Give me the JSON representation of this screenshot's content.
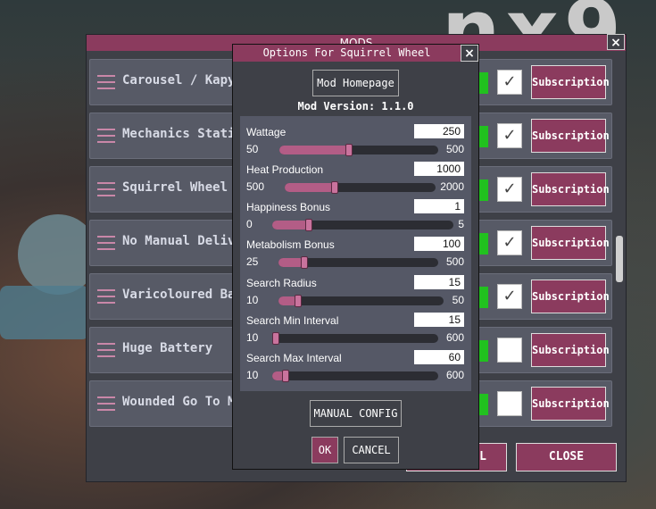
{
  "background": {
    "logo_text": "nx9"
  },
  "mods_window": {
    "title": "MODS",
    "close_icon": "×",
    "rows": [
      {
        "name": "Carousel / Карусель",
        "enabled": true,
        "subscription": "Subscription"
      },
      {
        "name": "Mechanics Station / ",
        "enabled": true,
        "subscription": "Subscription"
      },
      {
        "name": "Squirrel Wheel / Бе",
        "enabled": true,
        "subscription": "Subscription"
      },
      {
        "name": "No Manual Delivery",
        "enabled": true,
        "subscription": "Subscription"
      },
      {
        "name": "Varicoloured Balloon",
        "enabled": true,
        "subscription": "Subscription"
      },
      {
        "name": "Huge Battery",
        "enabled": false,
        "subscription": "Subscription"
      },
      {
        "name": "Wounded Go To Me",
        "enabled": false,
        "subscription": "Subscription"
      }
    ],
    "checkmark": "✓",
    "footer_left_fragment": "L",
    "close_button": "CLOSE"
  },
  "options_dialog": {
    "title": "Options For Squirrel Wheel",
    "close_icon": "×",
    "homepage_button": "Mod Homepage",
    "version": "Mod Version: 1.1.0",
    "settings": [
      {
        "label": "Wattage",
        "value": "250",
        "min": "50",
        "max": "500",
        "fraction": 0.44
      },
      {
        "label": "Heat Production",
        "value": "1000",
        "min": "500",
        "max": "2000",
        "fraction": 0.33
      },
      {
        "label": "Happiness Bonus",
        "value": "1",
        "min": "0",
        "max": "5",
        "fraction": 0.2
      },
      {
        "label": "Metabolism Bonus",
        "value": "100",
        "min": "25",
        "max": "500",
        "fraction": 0.16
      },
      {
        "label": "Search Radius",
        "value": "15",
        "min": "10",
        "max": "50",
        "fraction": 0.12
      },
      {
        "label": "Search Min Interval",
        "value": "15",
        "min": "10",
        "max": "600",
        "fraction": 0.01
      },
      {
        "label": "Search Max Interval",
        "value": "60",
        "min": "10",
        "max": "600",
        "fraction": 0.08
      }
    ],
    "manual_config_button": "MANUAL CONFIG",
    "ok_button": "OK",
    "cancel_button": "CANCEL"
  },
  "colors": {
    "accent": "#8b3b5e",
    "panel": "#3e4047",
    "slider_fill": "#b35d86",
    "enabled_green": "#21c11f"
  }
}
